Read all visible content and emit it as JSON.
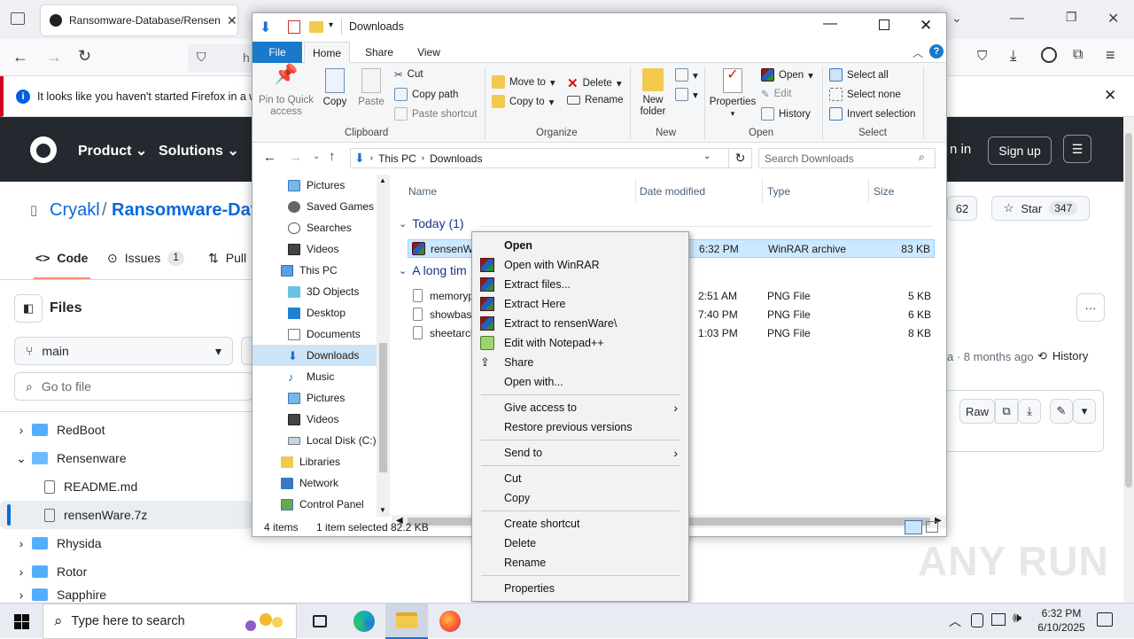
{
  "firefox": {
    "tab_title": "Ransomware-Database/Rensen",
    "url_fragment": "h",
    "notification": "It looks like you haven't started Firefox in a wh"
  },
  "github": {
    "menu": [
      "Product",
      "Solutions"
    ],
    "sign_in": "n in",
    "sign_up": "Sign up",
    "owner": "Cryakl",
    "separator": "/",
    "repo": "Ransomware-Dat",
    "tabs": {
      "code": "Code",
      "issues": "Issues",
      "issues_count": "1",
      "pull": "Pull"
    },
    "watch_count": "62",
    "star_label": "Star",
    "star_count": "347",
    "files_title": "Files",
    "branch": "main",
    "goto_placeholder": "Go to file",
    "commit_age": "a · 8 months ago",
    "history": "History",
    "raw": "Raw",
    "tree": [
      {
        "label": "RedBoot",
        "type": "folder",
        "expanded": false
      },
      {
        "label": "Rensenware",
        "type": "folder",
        "expanded": true
      },
      {
        "label": "README.md",
        "type": "file"
      },
      {
        "label": "rensenWare.7z",
        "type": "file",
        "selected": true
      },
      {
        "label": "Rhysida",
        "type": "folder",
        "expanded": false
      },
      {
        "label": "Rotor",
        "type": "folder",
        "expanded": false
      },
      {
        "label": "Sapphire",
        "type": "folder",
        "expanded": false
      }
    ]
  },
  "explorer": {
    "title": "Downloads",
    "ribbon_tabs": [
      "File",
      "Home",
      "Share",
      "View"
    ],
    "clipboard": {
      "pin": "Pin to Quick access",
      "copy": "Copy",
      "paste": "Paste",
      "cut": "Cut",
      "copy_path": "Copy path",
      "paste_shortcut": "Paste shortcut",
      "group": "Clipboard"
    },
    "organize": {
      "move_to": "Move to",
      "copy_to": "Copy to",
      "delete": "Delete",
      "rename": "Rename",
      "group": "Organize"
    },
    "new": {
      "new_folder": "New folder",
      "group": "New"
    },
    "open": {
      "properties": "Properties",
      "open": "Open",
      "edit": "Edit",
      "history": "History",
      "group": "Open"
    },
    "select": {
      "select_all": "Select all",
      "select_none": "Select none",
      "invert": "Invert selection",
      "group": "Select"
    },
    "breadcrumb": [
      "This PC",
      "Downloads"
    ],
    "search_placeholder": "Search Downloads",
    "nav": [
      "Pictures",
      "Saved Games",
      "Searches",
      "Videos",
      "This PC",
      "3D Objects",
      "Desktop",
      "Documents",
      "Downloads",
      "Music",
      "Pictures",
      "Videos",
      "Local Disk (C:)",
      "Libraries",
      "Network",
      "Control Panel"
    ],
    "columns": {
      "name": "Name",
      "date": "Date modified",
      "type": "Type",
      "size": "Size"
    },
    "groups": {
      "today": "Today (1)",
      "long_ago": "A long tim"
    },
    "files": [
      {
        "name": "rensenWa",
        "date": "6:32 PM",
        "type": "WinRAR archive",
        "size": "83 KB"
      },
      {
        "name": "memoryp",
        "date": "2:51 AM",
        "type": "PNG File",
        "size": "5 KB"
      },
      {
        "name": "showbasi",
        "date": "7:40 PM",
        "type": "PNG File",
        "size": "6 KB"
      },
      {
        "name": "sheetarch",
        "date": "1:03 PM",
        "type": "PNG File",
        "size": "8 KB"
      }
    ],
    "status": {
      "items": "4 items",
      "selected": "1 item selected",
      "size": "82.2 KB"
    }
  },
  "context_menu": {
    "open": "Open",
    "open_winrar": "Open with WinRAR",
    "extract_files": "Extract files...",
    "extract_here": "Extract Here",
    "extract_to": "Extract to rensenWare\\",
    "edit_npp": "Edit with Notepad++",
    "share": "Share",
    "open_with": "Open with...",
    "give_access": "Give access to",
    "restore": "Restore previous versions",
    "send_to": "Send to",
    "cut": "Cut",
    "copy": "Copy",
    "create_shortcut": "Create shortcut",
    "delete": "Delete",
    "rename": "Rename",
    "properties": "Properties"
  },
  "taskbar": {
    "search_placeholder": "Type here to search",
    "time": "6:32 PM",
    "date": "6/10/2025"
  },
  "watermark": "ANY RUN"
}
